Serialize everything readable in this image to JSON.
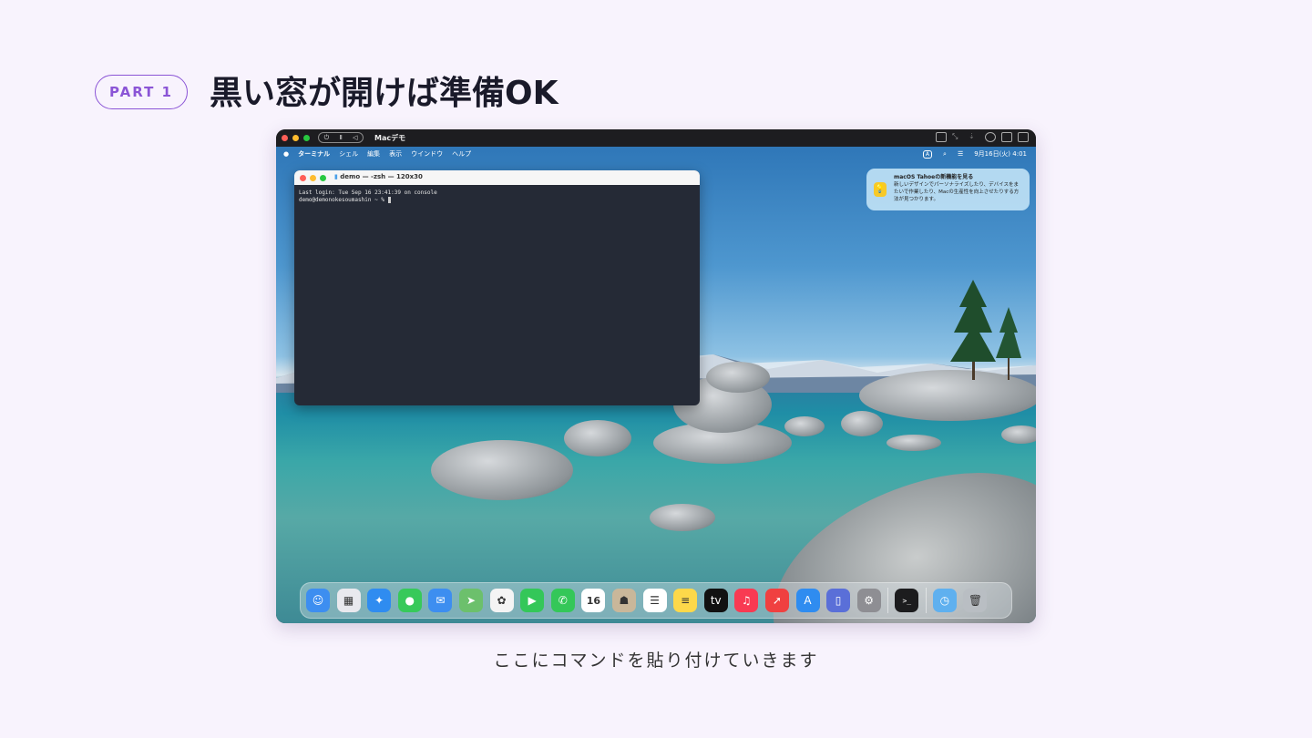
{
  "slide": {
    "part_label": "PART 1",
    "title": "黒い窓が開けば準備OK",
    "caption": "ここにコマンドを貼り付けていきます"
  },
  "vm_window": {
    "title": "Macデモ"
  },
  "menubar": {
    "apple": "",
    "items": [
      "ターミナル",
      "シェル",
      "編集",
      "表示",
      "ウインドウ",
      "ヘルプ"
    ],
    "input_indicator": "A",
    "clock": "9月16日(火) 4:01"
  },
  "terminal": {
    "title": "demo — -zsh — 120x30",
    "line1": "Last login: Tue Sep 16 23:41:39 on console",
    "prompt": "demo@demonokesoumashin ~ % "
  },
  "notification": {
    "title": "macOS Tahoeの新機能を見る",
    "body": "新しいデザインでパーソナライズしたり、デバイスをまたいで作業したり、Macの生産性を向上させたりする方法が見つかります。",
    "icon": "lightbulb-icon"
  },
  "dock": {
    "apps": [
      {
        "name": "finder-icon",
        "color": "#3d8ef0",
        "glyph": "☺"
      },
      {
        "name": "launchpad-icon",
        "color": "#e9e9ee",
        "glyph": "▦"
      },
      {
        "name": "safari-icon",
        "color": "#2f8cf0",
        "glyph": "✦"
      },
      {
        "name": "messages-icon",
        "color": "#37c95a",
        "glyph": "●"
      },
      {
        "name": "mail-icon",
        "color": "#3d8ef0",
        "glyph": "✉"
      },
      {
        "name": "maps-icon",
        "color": "#6cc06c",
        "glyph": "➤"
      },
      {
        "name": "photos-icon",
        "color": "#f4f4f4",
        "glyph": "✿"
      },
      {
        "name": "facetime-icon",
        "color": "#34c759",
        "glyph": "▶"
      },
      {
        "name": "phone-icon",
        "color": "#34c759",
        "glyph": "✆"
      },
      {
        "name": "calendar-icon",
        "color": "#ffffff",
        "glyph": "16"
      },
      {
        "name": "contacts-icon",
        "color": "#c9b79a",
        "glyph": "☗"
      },
      {
        "name": "reminders-icon",
        "color": "#ffffff",
        "glyph": "☰"
      },
      {
        "name": "notes-icon",
        "color": "#fdd84a",
        "glyph": "≡"
      },
      {
        "name": "tv-icon",
        "color": "#111111",
        "glyph": "tv"
      },
      {
        "name": "music-icon",
        "color": "#f83a52",
        "glyph": "♫"
      },
      {
        "name": "rocket-icon",
        "color": "#f04040",
        "glyph": "➚"
      },
      {
        "name": "app-store-icon",
        "color": "#2f8cf0",
        "glyph": "A"
      },
      {
        "name": "iphone-mirroring-icon",
        "color": "#5a6fd8",
        "glyph": "▯"
      },
      {
        "name": "system-settings-icon",
        "color": "#8e8e93",
        "glyph": "⚙"
      }
    ],
    "pinned": [
      {
        "name": "terminal-icon",
        "color": "#1c1c1e",
        "glyph": ">_"
      }
    ],
    "tray": [
      {
        "name": "downloads-folder-icon",
        "color": "#5fb0ef",
        "glyph": "◷"
      },
      {
        "name": "trash-icon",
        "color": "#b9bec3",
        "glyph": "🗑"
      }
    ]
  }
}
